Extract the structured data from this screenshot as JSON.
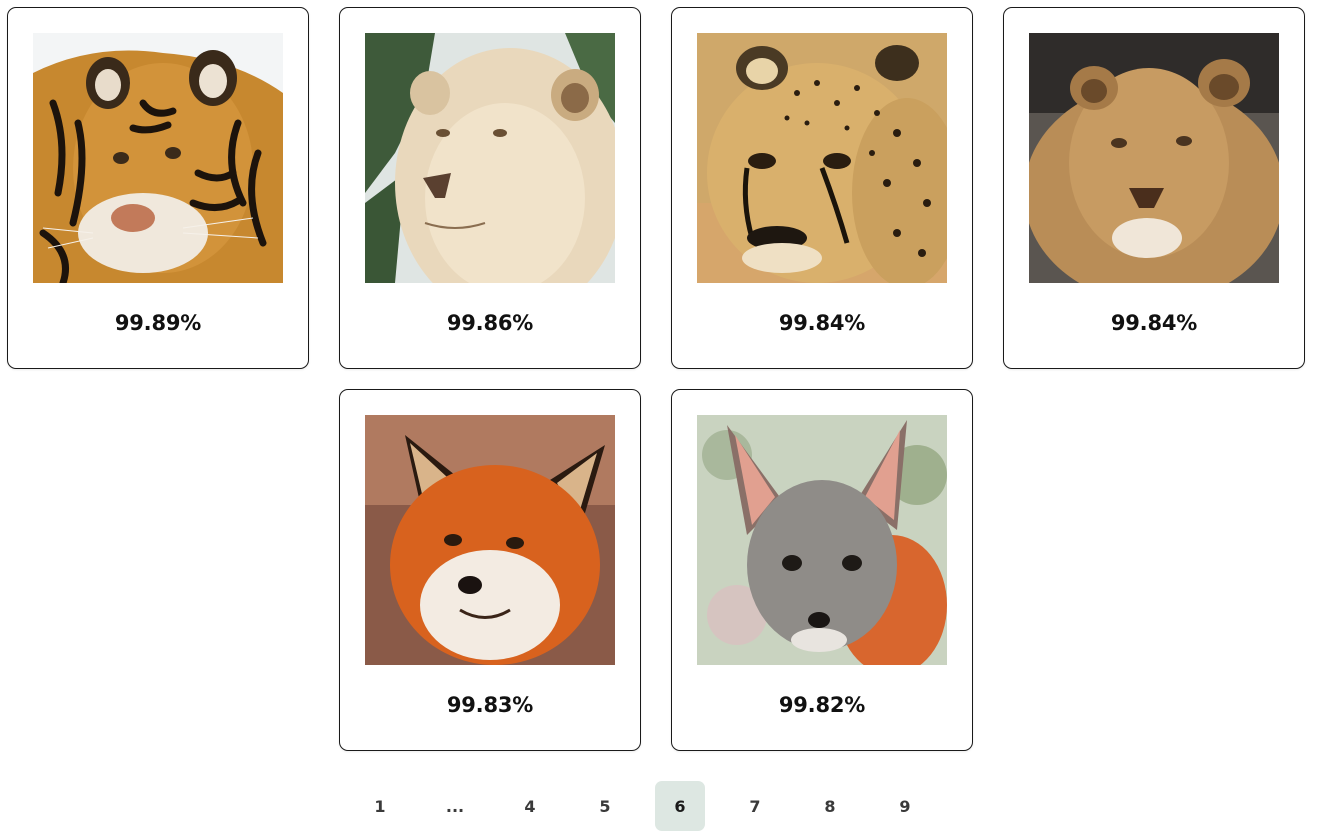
{
  "results": [
    {
      "animal": "tiger-icon",
      "score": "99.89%"
    },
    {
      "animal": "white-lion-icon",
      "score": "99.86%"
    },
    {
      "animal": "cheetah-icon",
      "score": "99.84%"
    },
    {
      "animal": "young-lion-icon",
      "score": "99.84%"
    },
    {
      "animal": "red-fox-icon",
      "score": "99.83%"
    },
    {
      "animal": "gray-fox-icon",
      "score": "99.82%"
    }
  ],
  "pagination": {
    "pages": [
      "1",
      "...",
      "4",
      "5",
      "6",
      "7",
      "8",
      "9"
    ],
    "current": "6",
    "active_color": "#dde7e2"
  }
}
